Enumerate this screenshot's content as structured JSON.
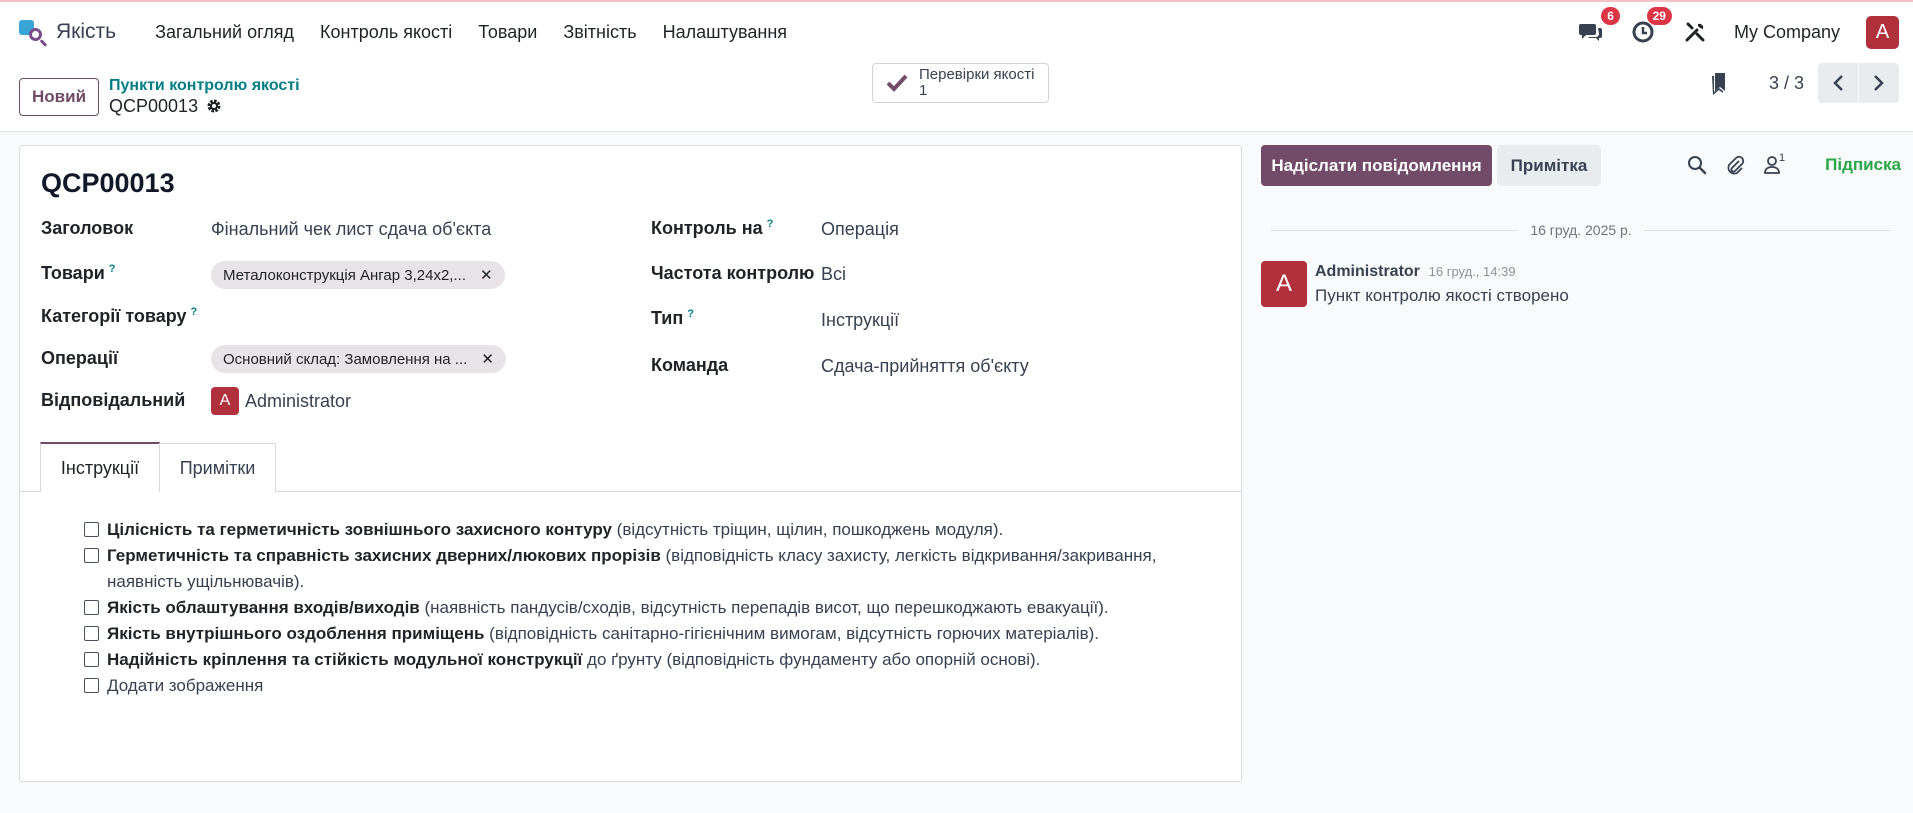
{
  "navbar": {
    "app_name": "Якість",
    "menu": [
      "Загальний огляд",
      "Контроль якості",
      "Товари",
      "Звітність",
      "Налаштування"
    ],
    "messages_count": "6",
    "activities_count": "29",
    "company": "My Company",
    "user_initial": "A"
  },
  "control_panel": {
    "new_label": "Новий",
    "breadcrumb": "Пункти контролю якості",
    "record_name": "QCP00013",
    "smart_button": {
      "label": "Перевірки якості",
      "count": "1"
    },
    "pager": "3 / 3"
  },
  "form": {
    "title": "QCP00013",
    "fields": {
      "title_label": "Заголовок",
      "title_value": "Фінальний чек лист сдача об'єкта",
      "products_label": "Товари",
      "products_tag": "Металоконструкція Ангар 3,24x2,...",
      "categories_label": "Категорії товару",
      "operations_label": "Операції",
      "operations_tag": "Основний склад: Замовлення на ...",
      "responsible_label": "Відповідальний",
      "responsible_initial": "A",
      "responsible_value": "Administrator",
      "control_on_label": "Контроль на",
      "control_on_value": "Операція",
      "frequency_label": "Частота контролю",
      "frequency_value": "Всі",
      "type_label": "Тип",
      "type_value": "Інструкції",
      "team_label": "Команда",
      "team_value": "Сдача-прийняття об'єкту",
      "help_mark": "?"
    },
    "tabs": [
      "Інструкції",
      "Примітки"
    ],
    "checklist": [
      {
        "bold": "Цілісність та герметичність зовнішнього захисного контуру",
        "rest": " (відсутність тріщин, щілин, пошкоджень модуля)."
      },
      {
        "bold": "Герметичність та справність захисних дверних/люкових прорізів",
        "rest": " (відповідність класу захисту, легкість відкривання/закривання, наявність ущільнювачів)."
      },
      {
        "bold": "Якість облаштування входів/виходів",
        "rest": " (наявність пандусів/сходів, відсутність перепадів висот, що перешкоджають евакуації)."
      },
      {
        "bold": "Якість внутрішнього оздоблення приміщень",
        "rest": " (відповідність санітарно-гігієнічним вимогам, відсутність горючих матеріалів)."
      },
      {
        "bold": "Надійність кріплення та стійкість модульної конструкції",
        "rest": " до ґрунту (відповідність фундаменту або опорній основі)."
      },
      {
        "bold": "",
        "rest": "Додати зображення"
      }
    ]
  },
  "chatter": {
    "send_label": "Надіслати повідомлення",
    "note_label": "Примітка",
    "followers_count": "1",
    "subscribe_label": "Підписка",
    "date_separator": "16 груд. 2025 р.",
    "message": {
      "initial": "A",
      "author": "Administrator",
      "date": "16 груд., 14:39",
      "body": "Пункт контролю якості створено"
    }
  },
  "colors": {
    "brand": "#714b67",
    "link": "#017e84",
    "badge": "#dc3545",
    "avatar": "#b0313c",
    "subscribe": "#28a745"
  }
}
